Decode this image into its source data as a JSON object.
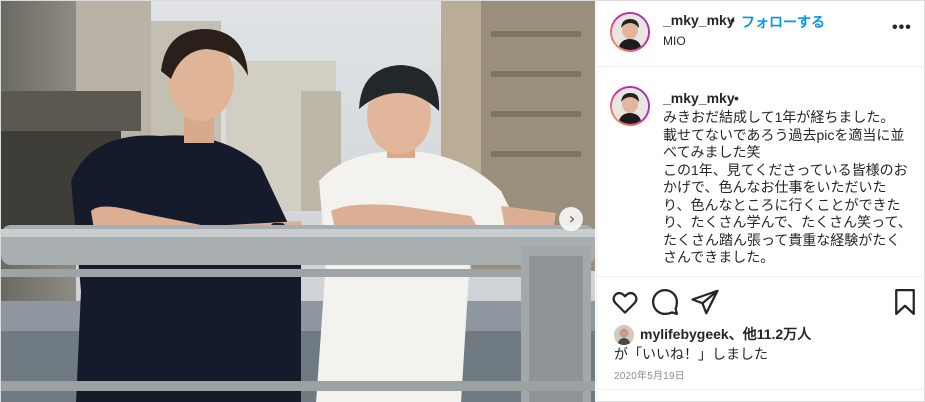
{
  "post": {
    "username": "_mky_mky",
    "separator": "•",
    "follow_label": "フォローする",
    "location": "MIO",
    "more_icon": "more-horizontal-icon",
    "caption": {
      "username": "_mky_mky",
      "separator": "•",
      "text": "みきおだ結成して1年が経ちました。\n載せてないであろう過去picを適当に並べてみました笑\nこの1年、見てくださっている皆様のおかげで、色んなお仕事をいただいたり、色んなところに行くことができたり、たくさん学んで、たくさん笑って、たくさん踏ん張って貴重な経験がたくさんできました。"
    },
    "actions": {
      "like_icon": "heart-icon",
      "comment_icon": "comment-icon",
      "share_icon": "paper-plane-icon",
      "save_icon": "bookmark-icon"
    },
    "likes": {
      "liker_name": "mylifebygeek",
      "others_text": "、他11.2万人",
      "liked_suffix": "が「いいね！」しました"
    },
    "date": "2020年5月19日",
    "carousel_next_icon": "chevron-right-icon",
    "colors": {
      "link_blue": "#0095f6",
      "text": "#262626",
      "muted": "#8e8e8e",
      "border": "#efefef"
    }
  }
}
